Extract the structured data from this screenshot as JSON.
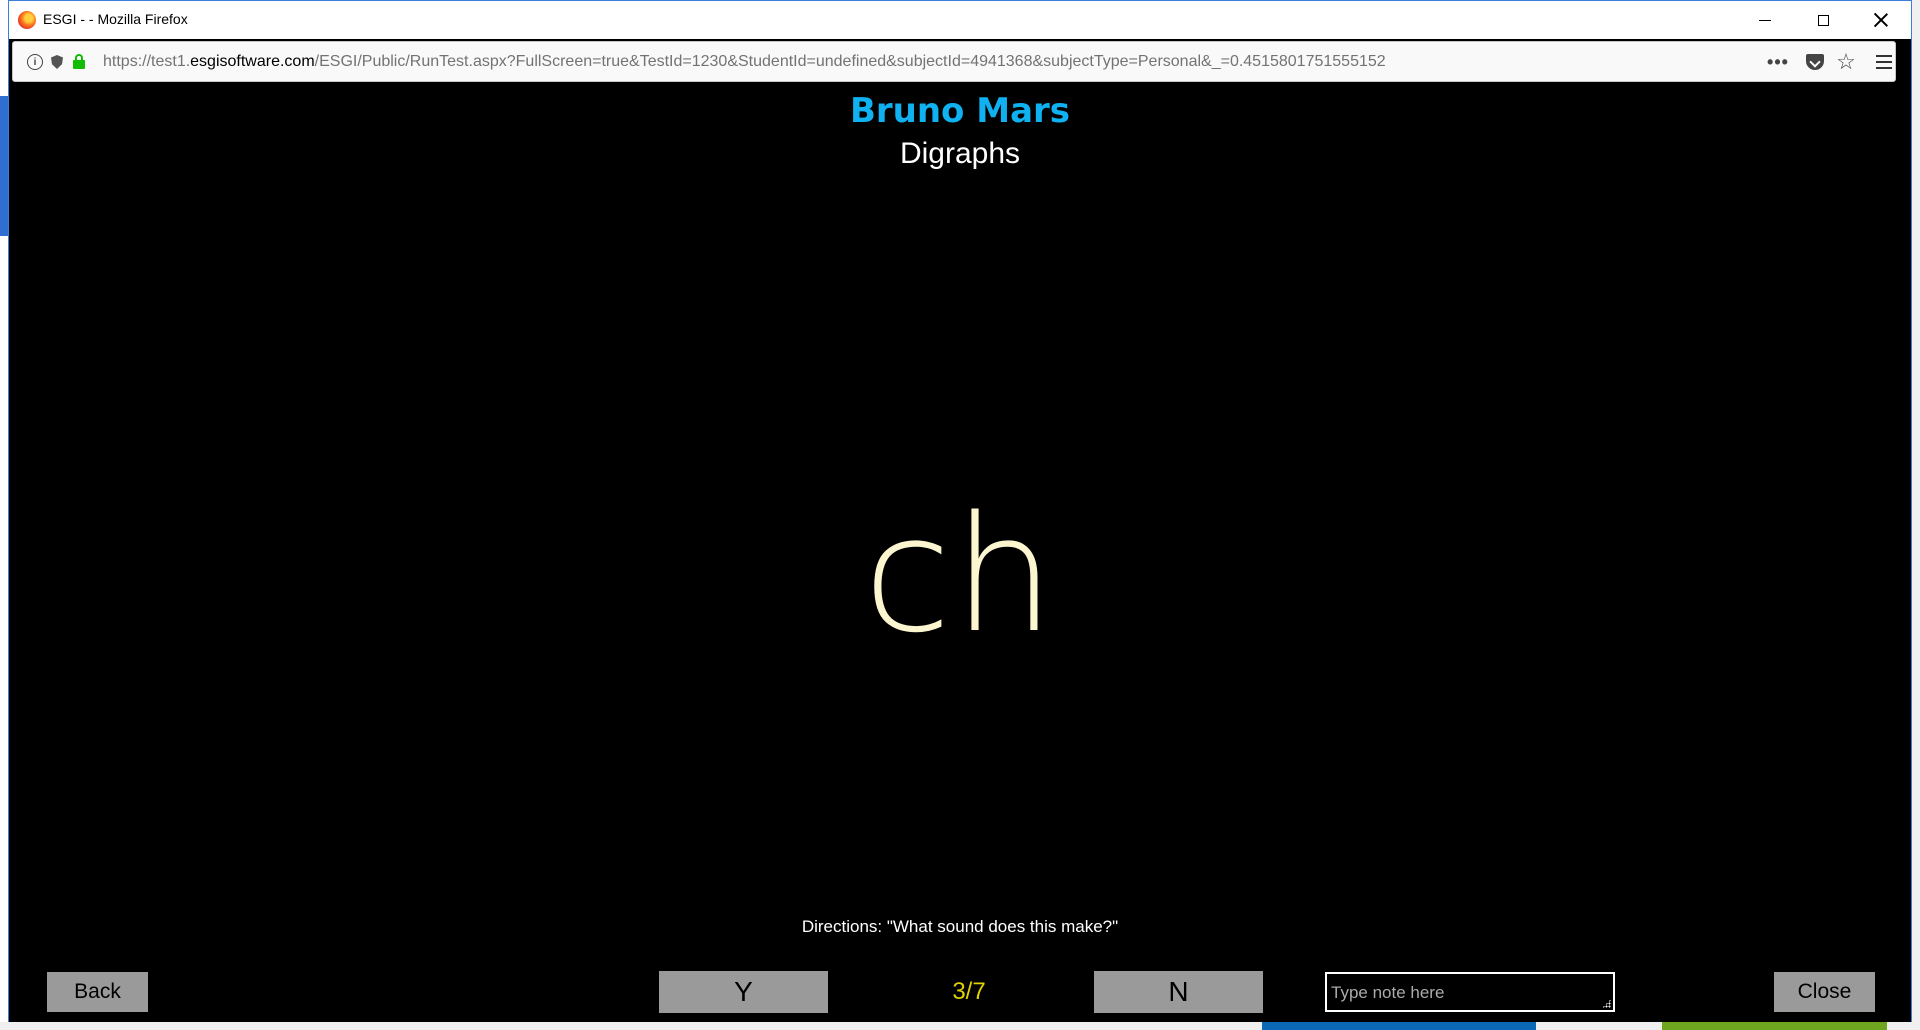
{
  "window": {
    "title": "ESGI - - Mozilla Firefox"
  },
  "browser": {
    "url_prefix": "https://test1.",
    "url_domain": "esgisoftware.com",
    "url_path": "/ESGI/Public/RunTest.aspx?FullScreen=true&TestId=1230&StudentId=undefined&subjectId=4941368&subjectType=Personal&_=0.4515801751555152",
    "page_actions_label": "•••"
  },
  "test": {
    "student_name": "Bruno Mars",
    "subject_title": "Digraphs",
    "question": "ch",
    "directions": "Directions: \"What sound does this make?\"",
    "progress": "3/7"
  },
  "controls": {
    "back_label": "Back",
    "yes_label": "Y",
    "no_label": "N",
    "close_label": "Close",
    "note_placeholder": "Type note here"
  },
  "colors": {
    "student_name": "#0fb1f0",
    "question": "#fbf6cf",
    "progress": "#e2d200",
    "button_bg": "#9a9a9a",
    "lock": "#12bc00"
  }
}
